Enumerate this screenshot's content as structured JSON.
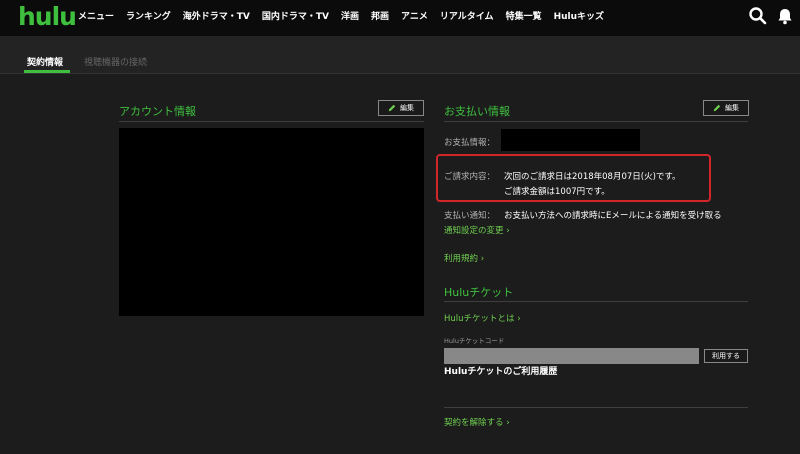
{
  "header": {
    "logo": "hulu",
    "nav": [
      "メニュー",
      "ランキング",
      "海外ドラマ・TV",
      "国内ドラマ・TV",
      "洋画",
      "邦画",
      "アニメ",
      "リアルタイム",
      "特集一覧",
      "Huluキッズ"
    ],
    "icons": [
      "search-icon",
      "bell-icon"
    ]
  },
  "tabs": {
    "active": "契約情報",
    "inactive": "視聴機器の接続"
  },
  "account": {
    "title": "アカウント情報",
    "edit": "編集"
  },
  "payment": {
    "title": "お支払い情報",
    "edit": "編集",
    "info_label": "お支払情報：",
    "billing_label": "ご請求内容：",
    "billing_line1": "次回のご請求日は2018年08月07日(火)です。",
    "billing_line2": "ご請求金額は1007円です。",
    "notice_label": "支払い通知：",
    "notice_value": "お支払い方法への請求時にEメールによる通知を受け取る",
    "notice_link": "通知設定の変更 ›",
    "terms_link": "利用規約 ›"
  },
  "ticket": {
    "title": "Huluチケット",
    "about_link": "Huluチケットとは ›",
    "code_label": "Huluチケットコード",
    "use_button": "利用する",
    "history": "Huluチケットのご利用履歴"
  },
  "cancel_link": "契約を解除する ›",
  "colors": {
    "accent": "#3ec03e",
    "highlight": "#d3262a",
    "background": "#1c1c1c"
  }
}
